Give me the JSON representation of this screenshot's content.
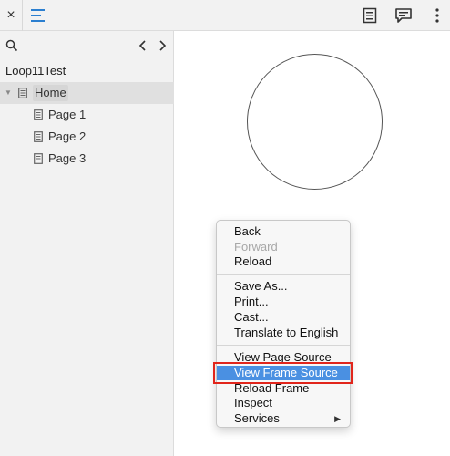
{
  "topbar": {
    "close_icon": "×",
    "icons": [
      "close-icon",
      "hamburger-menu-icon",
      "page-icon",
      "comment-icon",
      "more-vertical-icon"
    ],
    "accent": "#2b7fd0"
  },
  "sidebar": {
    "project_name": "Loop11Test",
    "icons": [
      "search-icon",
      "chevron-left-icon",
      "chevron-right-icon"
    ],
    "pages": [
      {
        "label": "Home",
        "selected": true
      },
      {
        "label": "Page 1"
      },
      {
        "label": "Page 2"
      },
      {
        "label": "Page 3"
      }
    ]
  },
  "context_menu": {
    "items": [
      {
        "label": "Back"
      },
      {
        "label": "Forward",
        "disabled": true
      },
      {
        "label": "Reload"
      },
      {
        "label": "Save As..."
      },
      {
        "label": "Print..."
      },
      {
        "label": "Cast..."
      },
      {
        "label": "Translate to English"
      },
      {
        "label": "View Page Source"
      },
      {
        "label": "View Frame Source",
        "highlighted": true
      },
      {
        "label": "Reload Frame"
      },
      {
        "label": "Inspect"
      },
      {
        "label": "Services",
        "submenu": true
      }
    ],
    "submenu_arrow": "▶",
    "highlight_color": "#4a90e2",
    "annotation_color": "#e1251b"
  }
}
